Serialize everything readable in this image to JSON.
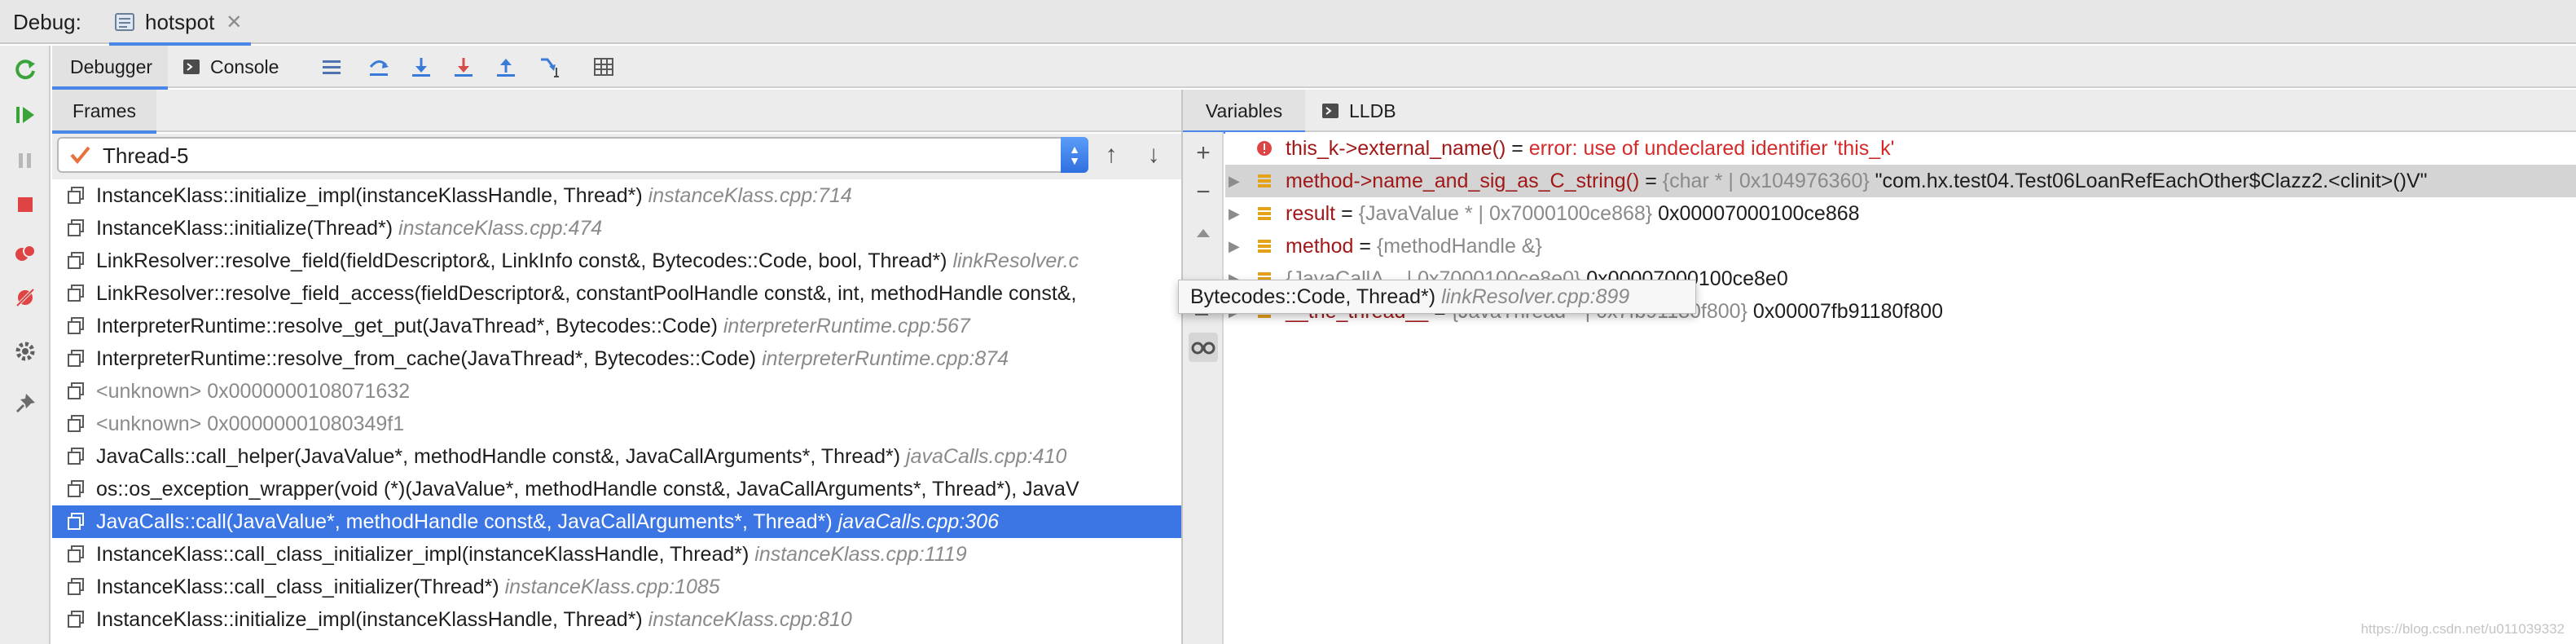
{
  "titlebar": {
    "label": "Debug:",
    "tab_name": "hotspot"
  },
  "toolbar": {
    "tabs": [
      {
        "label": "Debugger",
        "active": true
      },
      {
        "label": "Console",
        "active": false
      }
    ],
    "icons": [
      "menu-icon",
      "step-over-icon",
      "step-into-icon",
      "force-step-into-icon",
      "step-out-icon",
      "run-to-cursor-icon",
      "evaluate-table-icon"
    ]
  },
  "frames": {
    "tab_label": "Frames",
    "thread": "Thread-5",
    "rows": [
      {
        "func": "InstanceKlass::initialize_impl(instanceKlassHandle, Thread*)",
        "loc": "instanceKlass.cpp:714",
        "kind": "normal"
      },
      {
        "func": "InstanceKlass::initialize(Thread*)",
        "loc": "instanceKlass.cpp:474",
        "kind": "normal"
      },
      {
        "func": "LinkResolver::resolve_field(fieldDescriptor&, LinkInfo const&, Bytecodes::Code, bool, Thread*)",
        "loc": "linkResolver.c",
        "kind": "normal"
      },
      {
        "func": "LinkResolver::resolve_field_access(fieldDescriptor&, constantPoolHandle const&, int, methodHandle const&,",
        "loc": "",
        "kind": "normal"
      },
      {
        "func": "InterpreterRuntime::resolve_get_put(JavaThread*, Bytecodes::Code)",
        "loc": "interpreterRuntime.cpp:567",
        "kind": "normal"
      },
      {
        "func": "InterpreterRuntime::resolve_from_cache(JavaThread*, Bytecodes::Code)",
        "loc": "interpreterRuntime.cpp:874",
        "kind": "normal"
      },
      {
        "func": "<unknown>",
        "loc": "0x0000000108071632",
        "kind": "unknown"
      },
      {
        "func": "<unknown>",
        "loc": "0x00000001080349f1",
        "kind": "unknown"
      },
      {
        "func": "JavaCalls::call_helper(JavaValue*, methodHandle const&, JavaCallArguments*, Thread*)",
        "loc": "javaCalls.cpp:410",
        "kind": "normal"
      },
      {
        "func": "os::os_exception_wrapper(void (*)(JavaValue*, methodHandle const&, JavaCallArguments*, Thread*), JavaV",
        "loc": "",
        "kind": "normal"
      },
      {
        "func": "JavaCalls::call(JavaValue*, methodHandle const&, JavaCallArguments*, Thread*)",
        "loc": "javaCalls.cpp:306",
        "kind": "selected"
      },
      {
        "func": "InstanceKlass::call_class_initializer_impl(instanceKlassHandle, Thread*)",
        "loc": "instanceKlass.cpp:1119",
        "kind": "normal"
      },
      {
        "func": "InstanceKlass::call_class_initializer(Thread*)",
        "loc": "instanceKlass.cpp:1085",
        "kind": "normal"
      },
      {
        "func": "InstanceKlass::initialize_impl(instanceKlassHandle, Thread*)",
        "loc": "instanceKlass.cpp:810",
        "kind": "normal"
      }
    ]
  },
  "tooltip": {
    "func": "Bytecodes::Code, Thread*)",
    "loc": "linkResolver.cpp:899"
  },
  "variables": {
    "tabs": [
      {
        "label": "Variables",
        "active": true
      },
      {
        "label": "LLDB",
        "active": false
      }
    ],
    "rows": [
      {
        "name": "this_k->external_name()",
        "eq": " = ",
        "type": "",
        "value": "",
        "error": "error: use of undeclared identifier 'this_k'",
        "icon": "error",
        "expandable": false,
        "selected": false
      },
      {
        "name": "method->name_and_sig_as_C_string()",
        "eq": " = ",
        "type": "{char * | 0x104976360}",
        "value": " \"com.hx.test04.Test06LoanRefEachOther$Clazz2.<clinit>()V\"",
        "error": "",
        "icon": "field",
        "expandable": true,
        "selected": true
      },
      {
        "name": "result",
        "eq": " = ",
        "type": "{JavaValue * | 0x7000100ce868}",
        "value": " 0x00007000100ce868",
        "error": "",
        "icon": "field",
        "expandable": true,
        "selected": false
      },
      {
        "name": "method",
        "eq": " = ",
        "type": "{methodHandle &}",
        "value": "",
        "error": "",
        "icon": "field",
        "expandable": true,
        "selected": false
      },
      {
        "name": "",
        "eq": "",
        "type": "{JavaCallA... | 0x7000100ce8e0}",
        "value": " 0x00007000100ce8e0",
        "error": "",
        "icon": "field",
        "expandable": true,
        "selected": false
      },
      {
        "name": "__the_thread__",
        "eq": " = ",
        "type": "{JavaThread * | 0x7fb91180f800}",
        "value": " 0x00007fb91180f800",
        "error": "",
        "icon": "field",
        "expandable": true,
        "selected": false
      }
    ]
  },
  "watermark": "https://blog.csdn.net/u011039332",
  "colors": {
    "selection_blue": "#3b76e4",
    "tab_underline": "#4a86e8",
    "var_name": "#a01818",
    "error_red": "#d42a2a",
    "field_icon_orange": "#e3a21a"
  }
}
